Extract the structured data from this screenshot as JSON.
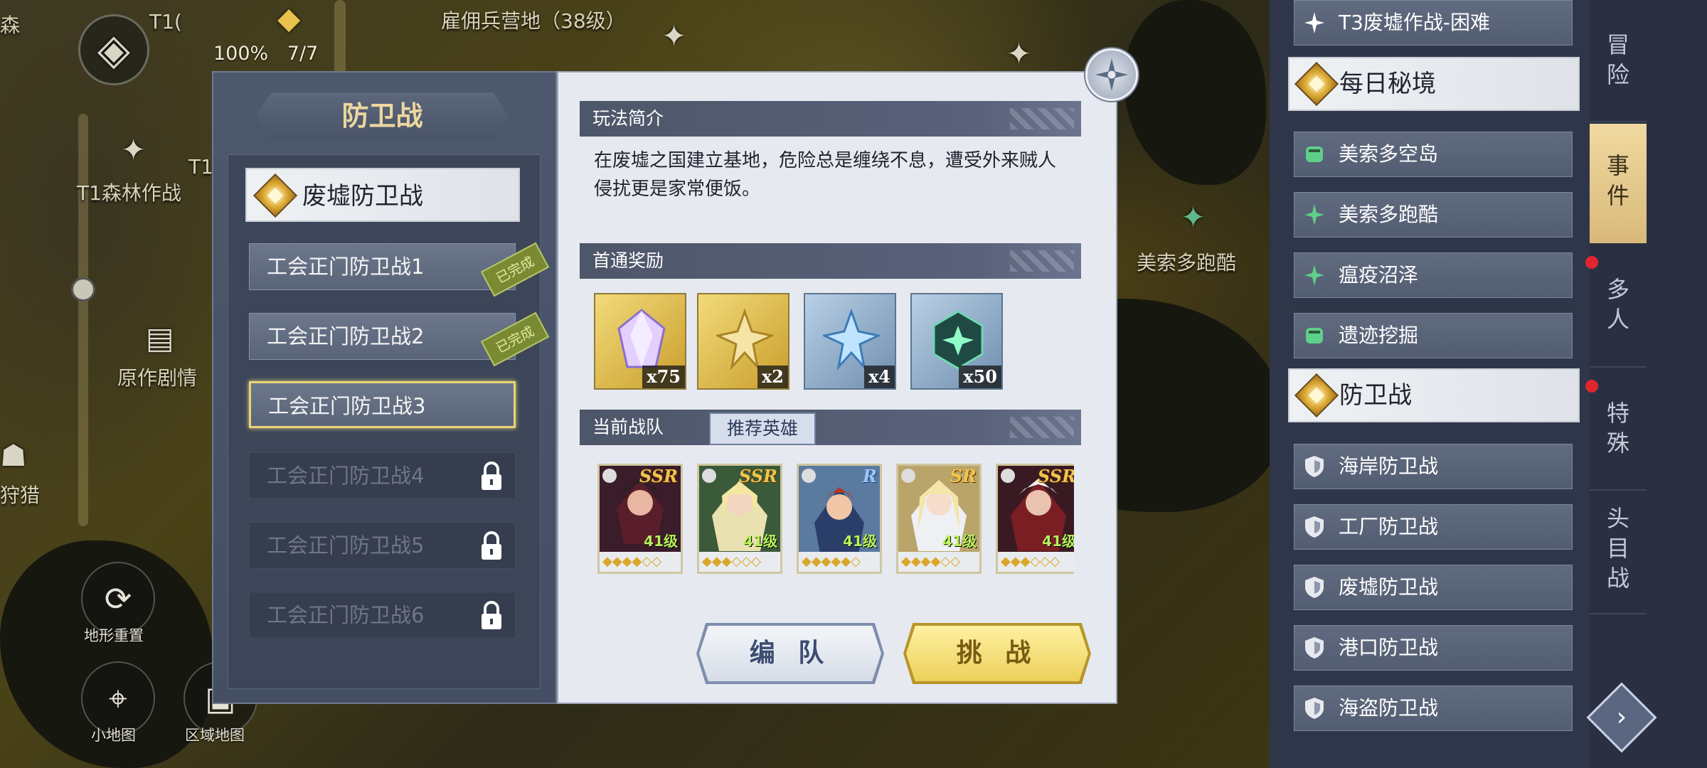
{
  "map": {
    "labels": [
      "雇佣兵营地（38级）",
      "T1森林作战",
      "原作剧情",
      "美索多跑酷",
      "T1(",
      "T1"
    ],
    "hud_percent": "100%",
    "hud_count": "7/7",
    "buttons": [
      "地形重置",
      "小地图",
      "区域地图"
    ],
    "partial_labels": [
      "森",
      "狩猎"
    ]
  },
  "left_panel": {
    "title": "防卫战",
    "category": "废墟防卫战",
    "stages": [
      {
        "label": "工会正门防卫战1",
        "stamp": "已完成"
      },
      {
        "label": "工会正门防卫战2",
        "stamp": "已完成"
      },
      {
        "label": "工会正门防卫战3",
        "stamp": ""
      },
      {
        "label": "工会正门防卫战4",
        "stamp": ""
      },
      {
        "label": "工会正门防卫战5",
        "stamp": ""
      },
      {
        "label": "工会正门防卫战6",
        "stamp": ""
      }
    ]
  },
  "detail": {
    "intro_title": "玩法简介",
    "intro_text_line1": "在废墟之国建立基地，危险总是缠绕不息，遭受外来贼人",
    "intro_text_line2": "侵扰更是家常便饭。",
    "reward_title": "首通奖励",
    "rewards": [
      {
        "count": "x75",
        "color": "#c9a0ff"
      },
      {
        "count": "x2",
        "color": "#e8c76a"
      },
      {
        "count": "x4",
        "color": "#7fbde8"
      },
      {
        "count": "x50",
        "color": "#3fcf8e"
      }
    ],
    "team_title": "当前战队",
    "recommend_label": "推荐英雄",
    "heroes": [
      {
        "rarity": "SSR",
        "level": "41级"
      },
      {
        "rarity": "SSR",
        "level": "41级"
      },
      {
        "rarity": "R",
        "level": "41级"
      },
      {
        "rarity": "SR",
        "level": "41级"
      },
      {
        "rarity": "SSR",
        "level": "41级"
      }
    ],
    "form_label": "编 队",
    "challenge_label": "挑 战"
  },
  "right_list": {
    "top_item": "T3废墟作战-困难",
    "header1": "每日秘境",
    "daily": [
      "美索多空岛",
      "美索多跑酷",
      "瘟疫沼泽",
      "遗迹挖掘"
    ],
    "header2": "防卫战",
    "defense": [
      "海岸防卫战",
      "工厂防卫战",
      "废墟防卫战",
      "港口防卫战",
      "海盗防卫战"
    ]
  },
  "tabs": [
    {
      "l1": "冒",
      "l2": "险",
      "l3": ""
    },
    {
      "l1": "事",
      "l2": "件",
      "l3": ""
    },
    {
      "l1": "多",
      "l2": "人",
      "l3": ""
    },
    {
      "l1": "特",
      "l2": "殊",
      "l3": ""
    },
    {
      "l1": "头",
      "l2": "目",
      "l3": "战"
    }
  ]
}
